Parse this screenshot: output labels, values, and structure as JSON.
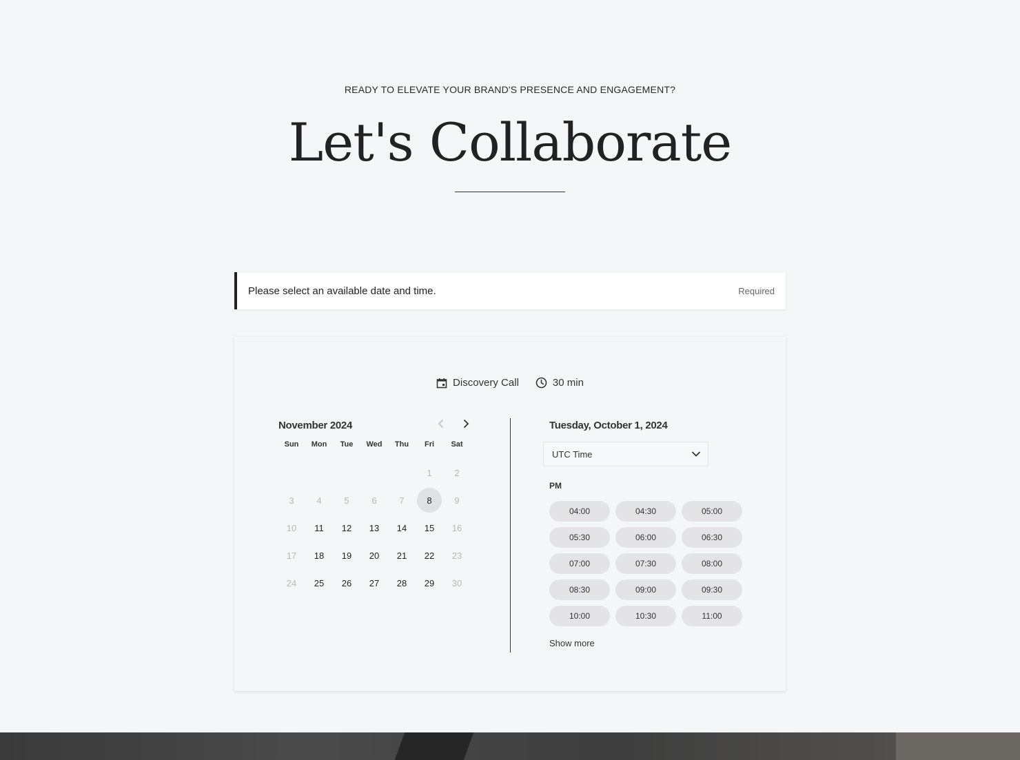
{
  "hero": {
    "eyebrow": "READY TO ELEVATE YOUR BRAND'S PRESENCE AND ENGAGEMENT?",
    "title": "Let's Collaborate"
  },
  "notice": {
    "text": "Please select an available date and time.",
    "required_label": "Required"
  },
  "booking": {
    "event_name": "Discovery Call",
    "event_icon": "calendar-icon",
    "duration": "30 min",
    "duration_icon": "clock-icon"
  },
  "calendar": {
    "month_label": "November 2024",
    "weekdays": [
      "Sun",
      "Mon",
      "Tue",
      "Wed",
      "Thu",
      "Fri",
      "Sat"
    ],
    "days": [
      {
        "label": "",
        "state": "blank"
      },
      {
        "label": "",
        "state": "blank"
      },
      {
        "label": "",
        "state": "blank"
      },
      {
        "label": "",
        "state": "blank"
      },
      {
        "label": "",
        "state": "blank"
      },
      {
        "label": "1",
        "state": "off"
      },
      {
        "label": "2",
        "state": "off"
      },
      {
        "label": "3",
        "state": "off"
      },
      {
        "label": "4",
        "state": "off"
      },
      {
        "label": "5",
        "state": "off"
      },
      {
        "label": "6",
        "state": "off"
      },
      {
        "label": "7",
        "state": "off"
      },
      {
        "label": "8",
        "state": "selected"
      },
      {
        "label": "9",
        "state": "off"
      },
      {
        "label": "10",
        "state": "off"
      },
      {
        "label": "11",
        "state": "on"
      },
      {
        "label": "12",
        "state": "on"
      },
      {
        "label": "13",
        "state": "on"
      },
      {
        "label": "14",
        "state": "on"
      },
      {
        "label": "15",
        "state": "on"
      },
      {
        "label": "16",
        "state": "off"
      },
      {
        "label": "17",
        "state": "off"
      },
      {
        "label": "18",
        "state": "on"
      },
      {
        "label": "19",
        "state": "on"
      },
      {
        "label": "20",
        "state": "on"
      },
      {
        "label": "21",
        "state": "on"
      },
      {
        "label": "22",
        "state": "on"
      },
      {
        "label": "23",
        "state": "off"
      },
      {
        "label": "24",
        "state": "off"
      },
      {
        "label": "25",
        "state": "on"
      },
      {
        "label": "26",
        "state": "on"
      },
      {
        "label": "27",
        "state": "on"
      },
      {
        "label": "28",
        "state": "on"
      },
      {
        "label": "29",
        "state": "on"
      },
      {
        "label": "30",
        "state": "off"
      }
    ]
  },
  "times": {
    "date_label": "Tuesday, October 1, 2024",
    "timezone": "UTC Time",
    "period": "PM",
    "slots": [
      "04:00",
      "04:30",
      "05:00",
      "05:30",
      "06:00",
      "06:30",
      "07:00",
      "07:30",
      "08:00",
      "08:30",
      "09:00",
      "09:30",
      "10:00",
      "10:30",
      "11:00"
    ],
    "show_more": "Show more"
  },
  "colors": {
    "background": "#f5f6f8",
    "accent_border": "#222222",
    "slot_bg": "#e4e4e6",
    "disabled_day": "#b8b8b8"
  }
}
